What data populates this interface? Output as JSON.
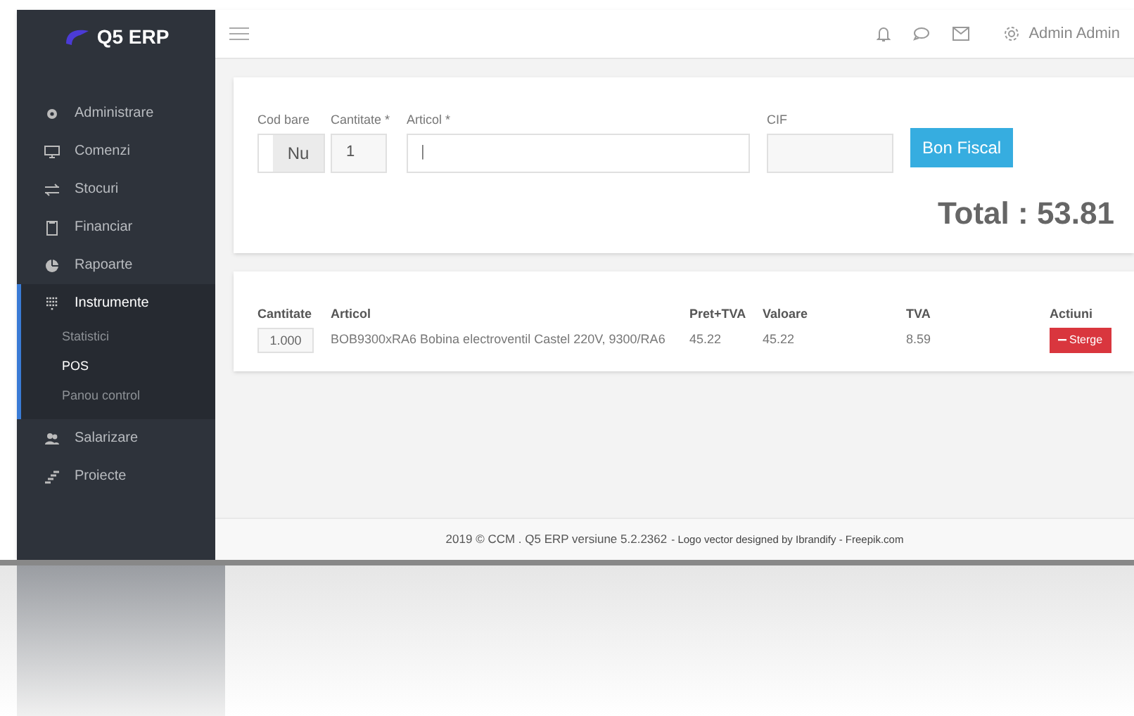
{
  "sidebar": {
    "logo": "Q5 ERP",
    "items": [
      {
        "label": "Administrare",
        "expanded": false
      },
      {
        "label": "Comenzi",
        "expanded": false
      },
      {
        "label": "Stocuri",
        "expanded": false
      },
      {
        "label": "Financiar",
        "expanded": false
      },
      {
        "label": "Rapoarte",
        "expanded": false
      },
      {
        "label": "Instrumente",
        "expanded": true,
        "children": [
          {
            "label": "Statistici",
            "selected": false
          },
          {
            "label": "POS",
            "selected": true
          },
          {
            "label": "Panou control",
            "selected": false
          }
        ]
      },
      {
        "label": "Salarizare",
        "expanded": false
      },
      {
        "label": "Proiecte",
        "expanded": false
      }
    ]
  },
  "header": {
    "user": "Admin Admin"
  },
  "form": {
    "barcode": {
      "label": "Cod bare",
      "value": "Nu"
    },
    "quantity": {
      "label": "Cantitate *",
      "value": "1"
    },
    "article": {
      "label": "Articol *",
      "value": "|"
    },
    "cif": {
      "label": "CIF"
    },
    "button": "Bon Fiscal",
    "total": "Total : 53.81"
  },
  "table": {
    "columns": [
      "Cantitate",
      "Articol",
      "Pret+TVA",
      "Valoare",
      "TVA",
      "Actiuni"
    ],
    "rows": [
      {
        "quantity": "1.000",
        "article": "BOB9300xRA6 Bobina electroventil Castel 220V, 9300/RA6",
        "price": "45.22",
        "value": "45.22",
        "vat": "8.59",
        "action": "Sterge"
      }
    ]
  },
  "footer": {
    "text": "2019 © CCM . Q5 ERP versiune 5.2.2362",
    "credit": "- Logo vector designed by Ibrandify - Freepik.com"
  }
}
